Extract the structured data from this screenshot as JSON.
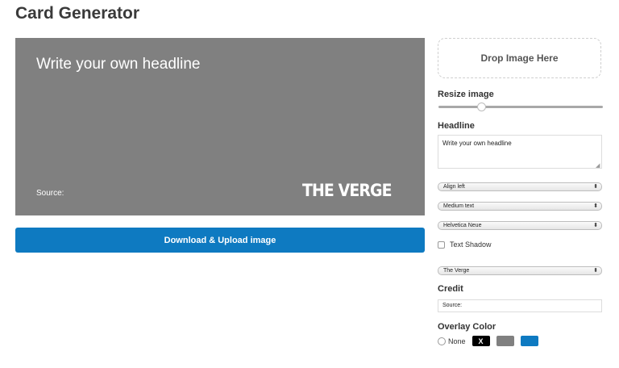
{
  "page": {
    "title": "Card Generator"
  },
  "card": {
    "headline": "Write your own headline",
    "source": "Source:",
    "logo": "THE VERGE"
  },
  "download_button": {
    "label": "Download & Upload image"
  },
  "panel": {
    "dropzone_label": "Drop Image Here",
    "resize_label": "Resize image",
    "resize_value": 0.26,
    "headline_label": "Headline",
    "headline_value": "Write your own headline",
    "align_select": "Align left",
    "size_select": "Medium text",
    "font_select": "Helvetica Neue",
    "text_shadow_label": "Text Shadow",
    "text_shadow_checked": false,
    "brand_select": "The Verge",
    "credit_label": "Credit",
    "credit_value": "Source:",
    "overlay_label": "Overlay Color",
    "overlay_none_label": "None",
    "overlay_swatches": [
      {
        "color": "#000000",
        "mark": "X"
      },
      {
        "color": "#808080",
        "mark": ""
      },
      {
        "color": "#0e7ac1",
        "mark": ""
      }
    ]
  }
}
